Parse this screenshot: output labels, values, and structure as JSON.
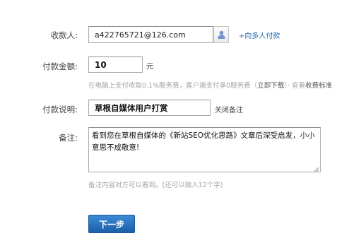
{
  "payee": {
    "label": "收款人:",
    "value": "a422765721@126.com",
    "contact_icon": "contact-person-icon",
    "multi_payee_link": "+向多人付款"
  },
  "amount": {
    "label": "付款金额:",
    "value": "10",
    "unit": "元",
    "fee_hint": "在电脑上支付收取0.1%服务费，客户端支付享0服务费（",
    "download_link": "立即下载",
    "fee_hint_mid": "）· 查看",
    "fee_standard_link": "收费标准"
  },
  "description": {
    "label": "付款说明:",
    "value": "草根自媒体用户打赏",
    "close_remark_link": "关闭备注"
  },
  "remark": {
    "label": "备注:",
    "value": "看到您在草根自媒体的《新站SEO优化思路》文章后深受启发，小小意思不成敬意!",
    "hint": "备注内容对方可以看到。(还可以输入12个字)"
  },
  "next_button": "下一步",
  "colors": {
    "link": "#1f68b6",
    "hint": "#a3a3a3",
    "button": "#1c5fa8"
  }
}
